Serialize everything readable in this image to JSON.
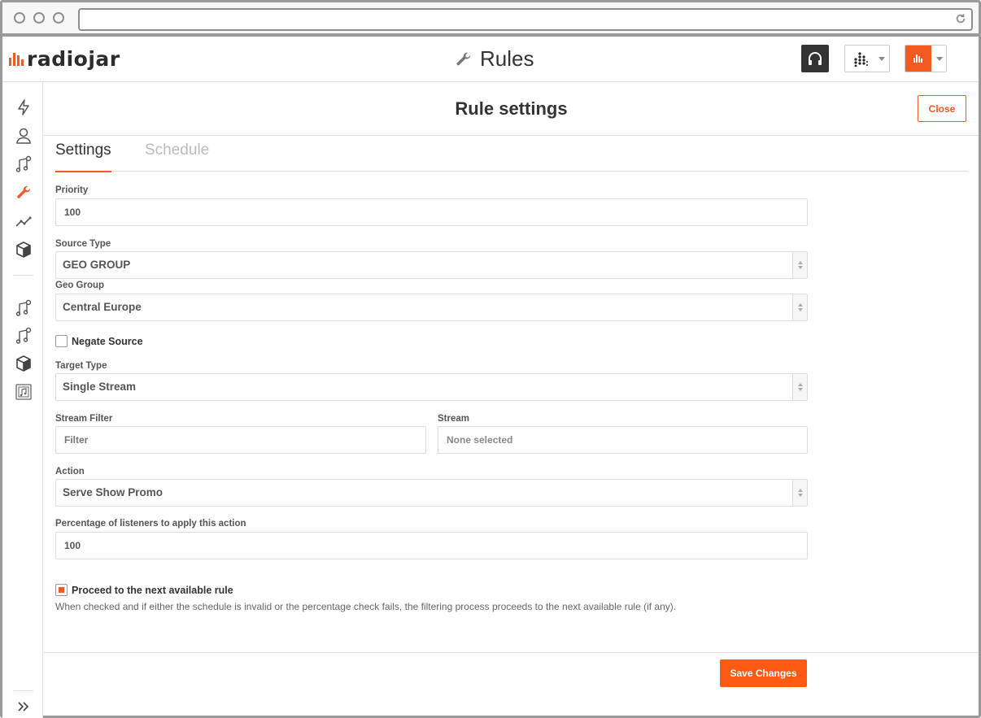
{
  "app": {
    "logo_text": "radiojar",
    "page_title": "Rules",
    "brand_color": "#f15a22"
  },
  "header": {
    "icons": [
      "wrench-icon",
      "headphones-icon",
      "stations-icon",
      "user-avatar-icon"
    ]
  },
  "sidebar": {
    "top_items": [
      {
        "icon": "lightning-icon"
      },
      {
        "icon": "user-icon"
      },
      {
        "icon": "music-note-icon"
      },
      {
        "icon": "wrench-icon",
        "active": true
      },
      {
        "icon": "analytics-icon"
      },
      {
        "icon": "box-icon"
      }
    ],
    "bottom_items": [
      {
        "icon": "music-note-icon"
      },
      {
        "icon": "music-note-icon"
      },
      {
        "icon": "box-icon"
      },
      {
        "icon": "music-file-icon"
      }
    ],
    "expand_icon": "double-chevron-right-icon"
  },
  "modal": {
    "title": "Rule settings",
    "close_label": "Close",
    "tabs": [
      {
        "label": "Settings",
        "active": true
      },
      {
        "label": "Schedule",
        "active": false
      }
    ]
  },
  "form": {
    "priority": {
      "label": "Priority",
      "value": "100"
    },
    "source_type": {
      "label": "Source Type",
      "value": "GEO GROUP"
    },
    "geo_group": {
      "label": "Geo Group",
      "value": "Central Europe"
    },
    "negate_source": {
      "label": "Negate Source",
      "checked": false
    },
    "target_type": {
      "label": "Target Type",
      "value": "Single Stream"
    },
    "stream_filter": {
      "label": "Stream Filter",
      "placeholder": "Filter",
      "value": ""
    },
    "stream": {
      "label": "Stream",
      "value": "None selected"
    },
    "action": {
      "label": "Action",
      "value": "Serve Show Promo"
    },
    "percentage": {
      "label": "Percentage of listeners to apply this action",
      "value": "100"
    },
    "proceed": {
      "label": "Proceed to the next available rule",
      "checked": true,
      "help": "When checked and if either the schedule is invalid or the percentage check fails, the filtering process proceeds to the next available rule (if any)."
    },
    "save_label": "Save Changes"
  }
}
